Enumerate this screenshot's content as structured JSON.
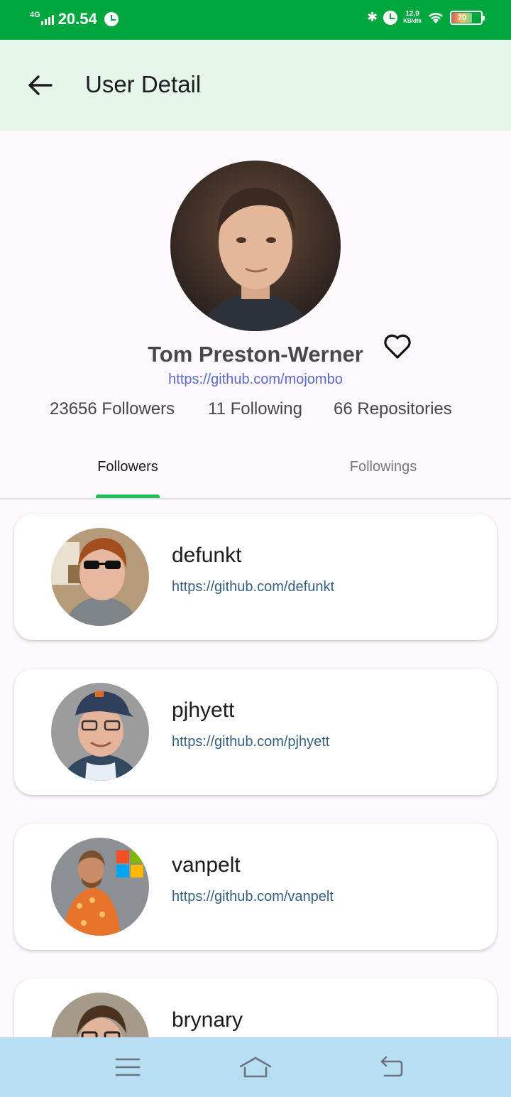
{
  "status_bar": {
    "network": "4G",
    "time": "20.54",
    "speed_value": "12,9",
    "speed_unit": "KB/dtk",
    "battery": "70"
  },
  "app_bar": {
    "title": "User Detail"
  },
  "profile": {
    "name": "Tom Preston-Werner",
    "url": "https://github.com/mojombo",
    "followers": "23656 Followers",
    "following": "11 Following",
    "repositories": "66 Repositories"
  },
  "tabs": [
    {
      "label": "Followers",
      "selected": true
    },
    {
      "label": "Followings",
      "selected": false
    }
  ],
  "users": [
    {
      "login": "defunkt",
      "url": "https://github.com/defunkt"
    },
    {
      "login": "pjhyett",
      "url": "https://github.com/pjhyett"
    },
    {
      "login": "vanpelt",
      "url": "https://github.com/vanpelt"
    },
    {
      "login": "brynary",
      "url": ""
    }
  ],
  "colors": {
    "status_bar": "#00a63e",
    "app_bar": "#e6f5ea",
    "tab_indicator": "#1fbf5c",
    "nav_bar": "#b8def3",
    "link": "#5a6ac9"
  },
  "icons": {
    "back": "arrow-left-icon",
    "favorite": "heart-outline-icon",
    "nav_menu": "menu-icon",
    "nav_home": "home-icon",
    "nav_back": "return-icon"
  }
}
